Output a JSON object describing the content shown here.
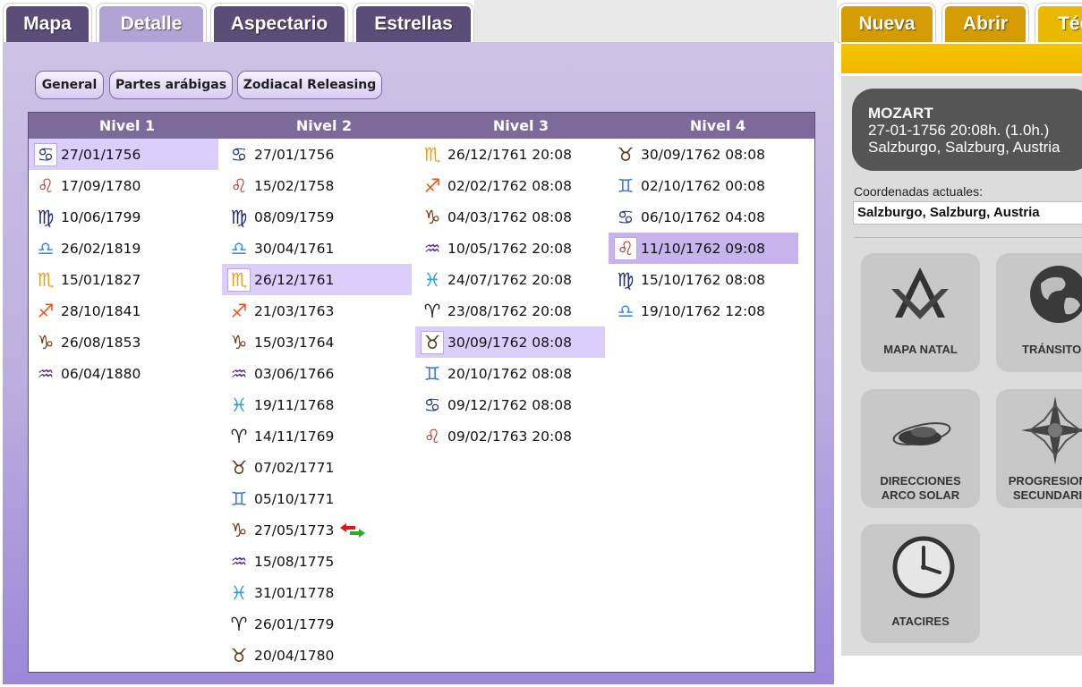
{
  "tabs": [
    {
      "label": "Mapa"
    },
    {
      "label": "Detalle"
    },
    {
      "label": "Aspectario"
    },
    {
      "label": "Estrellas"
    },
    {
      "label": "Nueva"
    },
    {
      "label": "Abrir"
    },
    {
      "label": "Téc"
    }
  ],
  "subtabs": [
    "General",
    "Partes arábigas",
    "Zodiacal Releasing"
  ],
  "columns": [
    {
      "header": "Nivel 1",
      "rows": [
        {
          "glyph": "♋",
          "sign": "cancer-icon",
          "color": "#2b3a78",
          "date": "27/01/1756"
        },
        {
          "glyph": "♌",
          "sign": "leo-icon",
          "color": "#c0392b",
          "date": "17/09/1780"
        },
        {
          "glyph": "♍",
          "sign": "virgo-icon",
          "color": "#1f2a78",
          "date": "10/06/1799"
        },
        {
          "glyph": "♎",
          "sign": "libra-icon",
          "color": "#3a8ee6",
          "date": "26/02/1819"
        },
        {
          "glyph": "♏",
          "sign": "scorpio-icon",
          "color": "#e8a020",
          "date": "15/01/1827"
        },
        {
          "glyph": "♐",
          "sign": "sagittarius-icon",
          "color": "#e8551c",
          "date": "28/10/1841"
        },
        {
          "glyph": "♑",
          "sign": "capricorn-icon",
          "color": "#7a3b14",
          "date": "26/08/1853"
        },
        {
          "glyph": "♒",
          "sign": "aquarius-icon",
          "color": "#5a2d91",
          "date": "06/04/1880"
        }
      ]
    },
    {
      "header": "Nivel 2",
      "rows": [
        {
          "glyph": "♋",
          "sign": "cancer-icon",
          "color": "#2b3a78",
          "date": "27/01/1756"
        },
        {
          "glyph": "♌",
          "sign": "leo-icon",
          "color": "#c0392b",
          "date": "15/02/1758"
        },
        {
          "glyph": "♍",
          "sign": "virgo-icon",
          "color": "#1f2a78",
          "date": "08/09/1759"
        },
        {
          "glyph": "♎",
          "sign": "libra-icon",
          "color": "#3a8ee6",
          "date": "30/04/1761"
        },
        {
          "glyph": "♏",
          "sign": "scorpio-icon",
          "color": "#e8a020",
          "date": "26/12/1761"
        },
        {
          "glyph": "♐",
          "sign": "sagittarius-icon",
          "color": "#e8551c",
          "date": "21/03/1763"
        },
        {
          "glyph": "♑",
          "sign": "capricorn-icon",
          "color": "#7a3b14",
          "date": "15/03/1764"
        },
        {
          "glyph": "♒",
          "sign": "aquarius-icon",
          "color": "#5a2d91",
          "date": "03/06/1766"
        },
        {
          "glyph": "♓",
          "sign": "pisces-icon",
          "color": "#2a9fd8",
          "date": "19/11/1768"
        },
        {
          "glyph": "♈",
          "sign": "aries-icon",
          "color": "#222222",
          "date": "14/11/1769"
        },
        {
          "glyph": "♉",
          "sign": "taurus-icon",
          "color": "#5a3a14",
          "date": "07/02/1771"
        },
        {
          "glyph": "♊",
          "sign": "gemini-icon",
          "color": "#3a78d8",
          "date": "05/10/1771"
        },
        {
          "glyph": "♑",
          "sign": "capricorn-icon",
          "color": "#7a3b14",
          "date": "27/05/1773"
        },
        {
          "glyph": "♒",
          "sign": "aquarius-icon",
          "color": "#5a2d91",
          "date": "15/08/1775"
        },
        {
          "glyph": "♓",
          "sign": "pisces-icon",
          "color": "#2a9fd8",
          "date": "31/01/1778"
        },
        {
          "glyph": "♈",
          "sign": "aries-icon",
          "color": "#222222",
          "date": "26/01/1779"
        },
        {
          "glyph": "♉",
          "sign": "taurus-icon",
          "color": "#5a3a14",
          "date": "20/04/1780"
        }
      ]
    },
    {
      "header": "Nivel 3",
      "rows": [
        {
          "glyph": "♏",
          "sign": "scorpio-icon",
          "color": "#e8a020",
          "date": "26/12/1761 20:08"
        },
        {
          "glyph": "♐",
          "sign": "sagittarius-icon",
          "color": "#e8551c",
          "date": "02/02/1762 08:08"
        },
        {
          "glyph": "♑",
          "sign": "capricorn-icon",
          "color": "#7a3b14",
          "date": "04/03/1762 08:08"
        },
        {
          "glyph": "♒",
          "sign": "aquarius-icon",
          "color": "#5a2d91",
          "date": "10/05/1762 20:08"
        },
        {
          "glyph": "♓",
          "sign": "pisces-icon",
          "color": "#2a9fd8",
          "date": "24/07/1762 20:08"
        },
        {
          "glyph": "♈",
          "sign": "aries-icon",
          "color": "#222222",
          "date": "23/08/1762 20:08"
        },
        {
          "glyph": "♉",
          "sign": "taurus-icon",
          "color": "#5a3a14",
          "date": "30/09/1762 08:08"
        },
        {
          "glyph": "♊",
          "sign": "gemini-icon",
          "color": "#3a78d8",
          "date": "20/10/1762 08:08"
        },
        {
          "glyph": "♋",
          "sign": "cancer-icon",
          "color": "#2b3a78",
          "date": "09/12/1762 08:08"
        },
        {
          "glyph": "♌",
          "sign": "leo-icon",
          "color": "#c0392b",
          "date": "09/02/1763 20:08"
        }
      ]
    },
    {
      "header": "Nivel 4",
      "rows": [
        {
          "glyph": "♉",
          "sign": "taurus-icon",
          "color": "#5a3a14",
          "date": "30/09/1762 08:08"
        },
        {
          "glyph": "♊",
          "sign": "gemini-icon",
          "color": "#3a78d8",
          "date": "02/10/1762 00:08"
        },
        {
          "glyph": "♋",
          "sign": "cancer-icon",
          "color": "#2b3a78",
          "date": "06/10/1762 04:08"
        },
        {
          "glyph": "♌",
          "sign": "leo-icon",
          "color": "#c0392b",
          "date": "11/10/1762 09:08"
        },
        {
          "glyph": "♍",
          "sign": "virgo-icon",
          "color": "#1f2a78",
          "date": "15/10/1762 08:08"
        },
        {
          "glyph": "♎",
          "sign": "libra-icon",
          "color": "#3a8ee6",
          "date": "19/10/1762 12:08"
        }
      ]
    }
  ],
  "info": {
    "name": "MOZART",
    "datetime": "27-01-1756 20:08h. (1.0h.)",
    "place": "Salzburgo, Salzburg, Austria"
  },
  "coords": {
    "label": "Coordenadas actuales:",
    "value": "Salzburgo, Salzburg, Austria"
  },
  "tiles": [
    {
      "label1": "MAPA NATAL",
      "label2": "",
      "icon": "compass-square-icon"
    },
    {
      "label1": "TRÁNSITOS",
      "label2": "",
      "icon": "globe-icon"
    },
    {
      "label1": "DIRECCIONES",
      "label2": "ARCO SOLAR",
      "icon": "planet-orbit-icon"
    },
    {
      "label1": "PROGRESIONES",
      "label2": "SECUNDARIAS",
      "icon": "compass-rose-icon"
    },
    {
      "label1": "ATACIRES",
      "label2": "",
      "icon": "clock-icon"
    }
  ]
}
